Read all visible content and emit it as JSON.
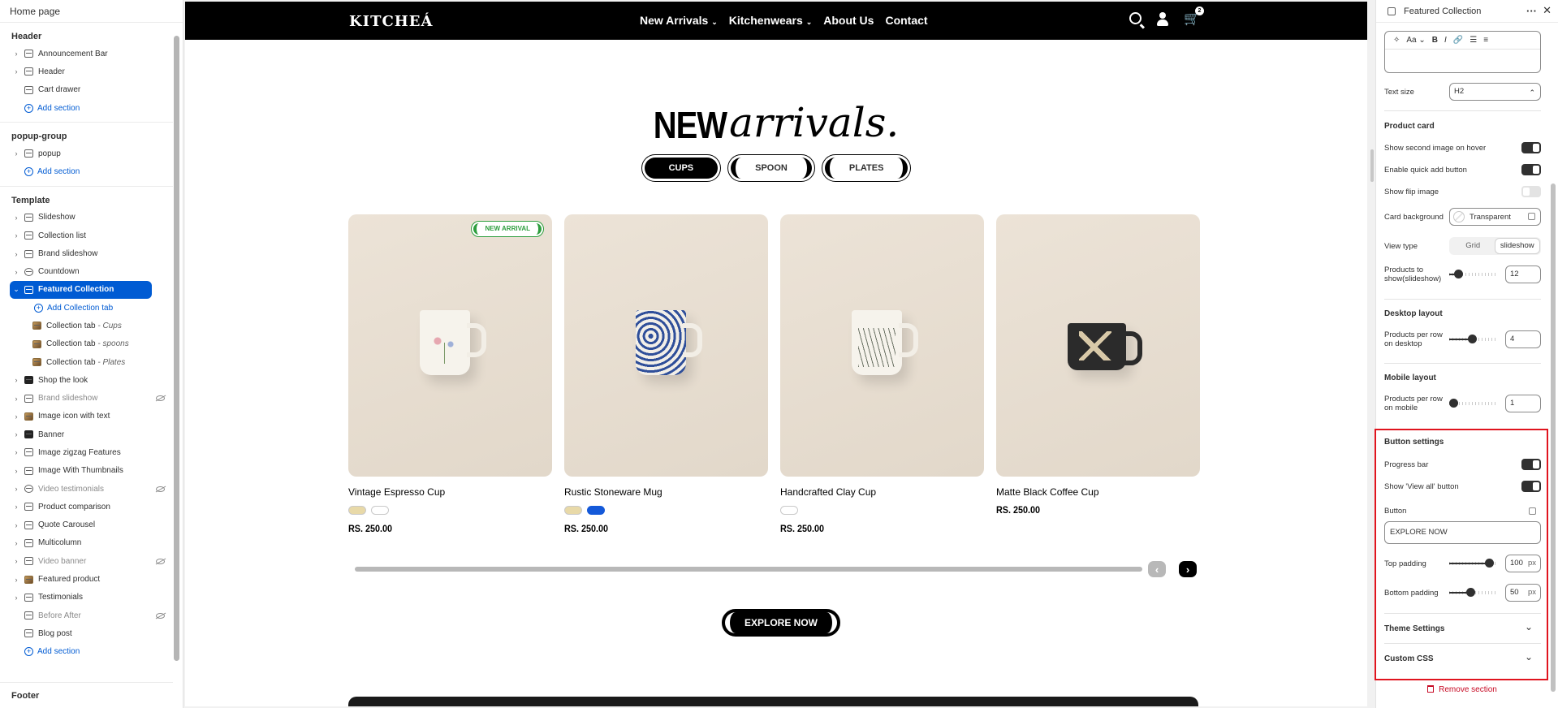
{
  "left_panel": {
    "title": "Home page",
    "groups": [
      {
        "title": "Header",
        "items": [
          "Announcement Bar",
          "Header",
          "Cart drawer"
        ],
        "add": "Add section"
      },
      {
        "title": "popup-group",
        "items": [
          "popup"
        ],
        "add": "Add section"
      },
      {
        "title": "Template"
      }
    ],
    "template_items": {
      "slideshow": "Slideshow",
      "collection_list": "Collection list",
      "brand_slideshow": "Brand slideshow",
      "countdown": "Countdown",
      "featured_collection": "Featured Collection",
      "add_collection_tab": "Add Collection tab",
      "collection_tab_label": "Collection tab",
      "tab_cups": "- Cups",
      "tab_spoons": "- spoons",
      "tab_plates": "- Plates",
      "shop_the_look": "Shop the look",
      "brand_slideshow_2": "Brand slideshow",
      "image_icon_text": "Image icon with text",
      "banner": "Banner",
      "image_zigzag": "Image zigzag Features",
      "image_thumbnails": "Image With Thumbnails",
      "video_testimonials": "Video testimonials",
      "product_comparison": "Product comparison",
      "quote_carousel": "Quote Carousel",
      "multicolumn": "Multicolumn",
      "video_banner": "Video banner",
      "featured_product": "Featured product",
      "testimonials": "Testimonials",
      "before_after": "Before After",
      "blog_post": "Blog post",
      "add_section": "Add section"
    },
    "footer": "Footer"
  },
  "store": {
    "logo": "KITCHEÁ",
    "menu": [
      "New Arrivals",
      "Kitchenwears",
      "About Us",
      "Contact"
    ],
    "cart_count": "2",
    "heading_bold": "NEW",
    "heading_script": "arrivals.",
    "tabs": [
      "CUPS",
      "SPOON",
      "PLATES"
    ],
    "badge": "NEW ARRIVAL",
    "products": [
      {
        "title": "Vintage Espresso Cup",
        "price": "RS. 250.00",
        "swatches": [
          "#e8d9a8",
          "#ffffff"
        ]
      },
      {
        "title": "Rustic Stoneware Mug",
        "price": "RS. 250.00",
        "swatches": [
          "#e8d9a8",
          "#1459d9"
        ]
      },
      {
        "title": "Handcrafted Clay Cup",
        "price": "RS. 250.00",
        "swatches": [
          "#ffffff"
        ]
      },
      {
        "title": "Matte Black Coffee Cup",
        "price": "RS. 250.00",
        "swatches": []
      }
    ],
    "explore_button": "EXPLORE NOW",
    "progress_fraction": 1
  },
  "settings": {
    "panel_title": "Featured Collection",
    "rte_toolbar": [
      "Aa",
      "B",
      "I"
    ],
    "text_size_label": "Text size",
    "text_size_value": "H2",
    "product_card_title": "Product card",
    "show_second_image": "Show second image on hover",
    "show_second_image_on": true,
    "enable_quick_add": "Enable quick add button",
    "enable_quick_add_on": true,
    "show_flip_image": "Show flip image",
    "show_flip_image_on": false,
    "card_background_label": "Card background",
    "card_background_value": "Transparent",
    "view_type_label": "View type",
    "view_type_options": [
      "Grid",
      "slideshow"
    ],
    "view_type_selected": "slideshow",
    "products_to_show_label": "Products to show(slideshow)",
    "products_to_show_value": "12",
    "desktop_layout_title": "Desktop layout",
    "per_row_desktop_label": "Products per row on desktop",
    "per_row_desktop_value": "4",
    "mobile_layout_title": "Mobile layout",
    "per_row_mobile_label": "Products per row on mobile",
    "per_row_mobile_value": "1",
    "button_settings_title": "Button settings",
    "progress_bar_label": "Progress bar",
    "progress_bar_on": true,
    "view_all_label": "Show 'View all' button",
    "view_all_on": true,
    "button_label": "Button",
    "button_value": "EXPLORE NOW",
    "top_padding_label": "Top padding",
    "top_padding_value": "100",
    "bottom_padding_label": "Bottom padding",
    "bottom_padding_value": "50",
    "unit": "px",
    "theme_settings": "Theme Settings",
    "custom_css": "Custom CSS",
    "remove_section": "Remove section"
  },
  "colors": {
    "accent": "#005bd3",
    "danger": "#c70a24",
    "highlight": "#e0141e",
    "badge_green": "#2e9e3e"
  }
}
